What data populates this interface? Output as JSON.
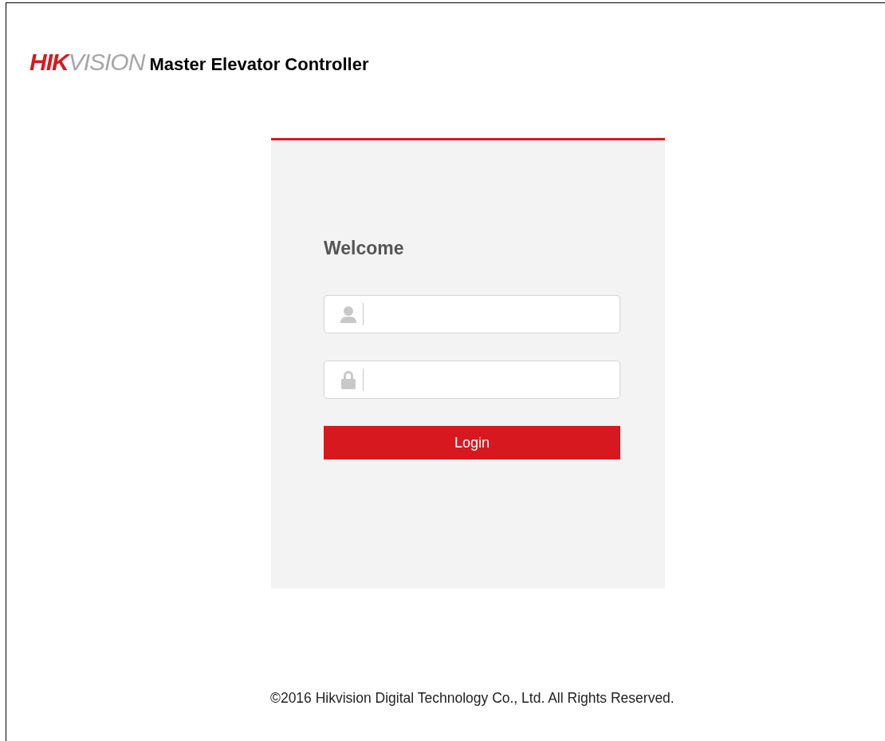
{
  "header": {
    "logo_primary": "HIK",
    "logo_secondary": "VISION",
    "title": "Master Elevator Controller"
  },
  "login": {
    "heading": "Welcome",
    "fields": [
      {
        "kind": "username"
      },
      {
        "kind": "password"
      }
    ],
    "button": "Login"
  },
  "footer": "©2016 Hikvision Digital Technology Co., Ltd. All Rights Reserved."
}
